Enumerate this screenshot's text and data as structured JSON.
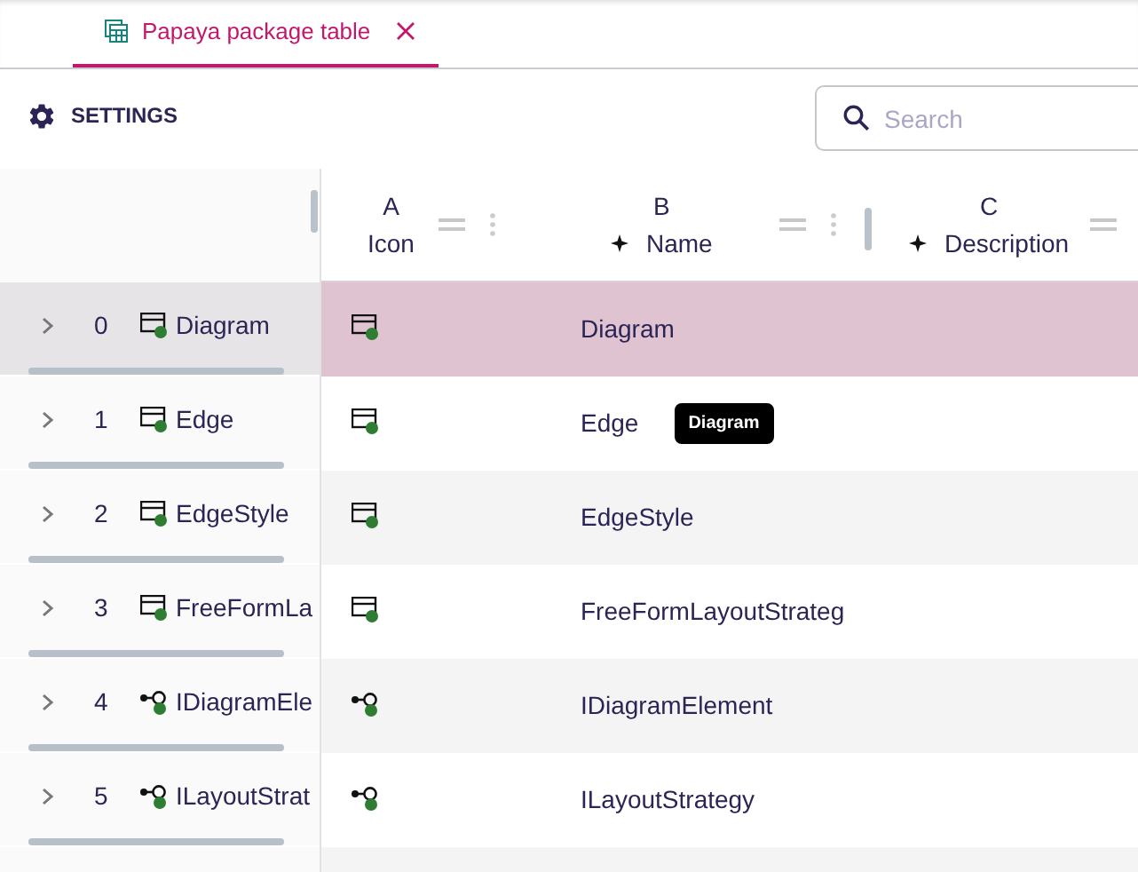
{
  "tab": {
    "label": "Papaya package table",
    "selected": true
  },
  "toolbar": {
    "settings": "SETTINGS",
    "search": {
      "placeholder": "Search"
    }
  },
  "columns": [
    {
      "letter": "A",
      "label": "Icon",
      "kind": "plain"
    },
    {
      "letter": "B",
      "label": "Name",
      "kind": "formula"
    },
    {
      "letter": "C",
      "label": "Description",
      "kind": "formula"
    }
  ],
  "rows": [
    {
      "index": "0",
      "kind": "class",
      "label": "Diagram",
      "name": "Diagram",
      "selected": true
    },
    {
      "index": "1",
      "kind": "class",
      "label": "Edge",
      "name": "Edge",
      "selected": false,
      "tooltip": "Diagram"
    },
    {
      "index": "2",
      "kind": "class",
      "label": "EdgeStyle",
      "name": "EdgeStyle",
      "selected": false
    },
    {
      "index": "3",
      "kind": "class",
      "label": "FreeFormLa",
      "name": "FreeFormLayoutStrateg",
      "selected": false
    },
    {
      "index": "4",
      "kind": "interface",
      "label": "IDiagramEle",
      "name": "IDiagramElement",
      "selected": false
    },
    {
      "index": "5",
      "kind": "interface",
      "label": "ILayoutStrat",
      "name": "ILayoutStrategy",
      "selected": false
    }
  ]
}
